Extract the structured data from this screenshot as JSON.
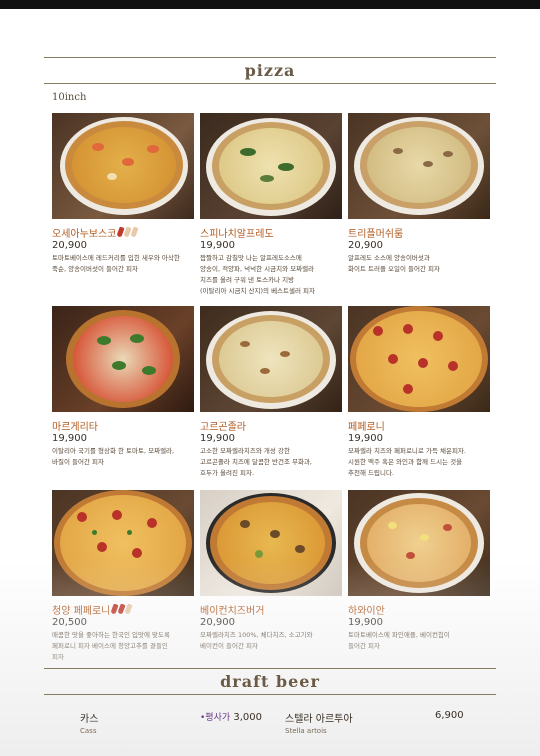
{
  "pizza_section": {
    "title": "pizza",
    "size": "10inch"
  },
  "pizzas": [
    {
      "name": "오세아누보스코",
      "spice": 1,
      "price": "20,900",
      "desc": "토마토베이스에 레드커리를 입힌 새우와 아삭한\n죽순, 양송이버섯이 들어간 피자"
    },
    {
      "name": "스피나치알프레도",
      "spice": 0,
      "price": "19,900",
      "desc": "짭짤하고 감칠맛 나는 알프레도소스에\n양송이, 적양파, 넉넉한 시금치와 모짜렐라\n치즈를 올려 구워 낸 토스카나 지방\n(이탈리아 시금치 산지)의 베스트셀러 피자"
    },
    {
      "name": "트리플머쉬룸",
      "spice": 0,
      "price": "20,900",
      "desc": "알프레도 소스에 양송이버섯과\n화이트 트러플 오일이 들어간 피자"
    },
    {
      "name": "마르게리타",
      "spice": 0,
      "price": "19,900",
      "desc": "이탈리아 국기를 형상화 한 토마토, 모짜렐라,\n바질이 들어간 피자"
    },
    {
      "name": "고르곤졸라",
      "spice": 0,
      "price": "19,900",
      "desc": "고소한 모짜렐라치즈와 개성 강한\n고르곤졸라 치즈에 달콤한 반건조 무화과,\n호두가 올려진 피자."
    },
    {
      "name": "페페로니",
      "spice": 0,
      "price": "19,900",
      "desc": "모짜렐라 치즈와 페퍼로니로 가득 채운피자.\n시원한 맥주 혹은 와인과 함께 드시는 것을\n추천해 드립니다."
    },
    {
      "name": "청양 페페로니",
      "spice": 2,
      "price": "20,500",
      "desc": "매콤한 맛을 좋아하는 한국인 입맛에 맞도록\n페퍼로니 피자 베이스에 청양고추를 곁들인\n피자"
    },
    {
      "name": "베이컨치즈버거",
      "spice": 0,
      "price": "20,900",
      "desc": "모짜렐라치즈 100%, 체다치즈, 소고기와\n베이컨이 들어간 피자"
    },
    {
      "name": "하와이안",
      "spice": 0,
      "price": "19,900",
      "desc": "토마토베이스에 파인애플, 베이컨칩이\n들어간 피자"
    }
  ],
  "beer_section": {
    "title": "draft beer"
  },
  "beers": [
    {
      "name": "카스",
      "sub": "Cass",
      "note": "•평사가",
      "price": "3,000"
    },
    {
      "name": "스텔라 아르투아",
      "sub": "Stella artois",
      "note": "",
      "price": "6,900"
    }
  ],
  "colors": {
    "accent": "#b25a1f",
    "rule": "#8a7a5e",
    "title": "#6b5a45",
    "chili_red": "#c0392b",
    "chili_pale": "#e8c9a8"
  }
}
